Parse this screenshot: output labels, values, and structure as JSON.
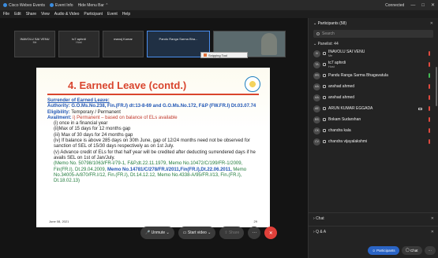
{
  "titlebar": {
    "app": "Cisco Webex Events",
    "event": "Event Info",
    "hide_menu": "Hide Menu Bar",
    "connected": "Connected",
    "win_min": "—",
    "win_max": "□",
    "win_close": "✕"
  },
  "menubar": {
    "items": [
      "File",
      "Edit",
      "Share",
      "View",
      "Audio & Video",
      "Participant",
      "Event",
      "Help"
    ]
  },
  "thumbs": [
    {
      "name": "INAVOLU SAI VENU",
      "sub": "Me"
    },
    {
      "name": "tc7 aphrdi",
      "sub": "Host"
    },
    {
      "name": "manoj Kumar",
      "sub": ""
    },
    {
      "name": "Pandu Ranga Sarma Bha..."
    }
  ],
  "snipping_tool": "Snipping Tool",
  "slide": {
    "title": "4. Earned Leave (contd.)",
    "lines": {
      "l1": "Surrender of Earned Leave:",
      "l2a": "Authority:",
      "l2b": " G.O.Ms.No.238, Fin.(FR.I) dt:13-8-69 and G.O.Ms.No.172, F&P (FW.FR.I) Dt.03.07.74",
      "l3a": "Eligibility:",
      "l3b": " Temporary / Permanent",
      "l4a": "Availment:",
      "l4b": " i) Permanent – based on balance of ELs available",
      "l5": "(i) once in a financial year",
      "l6": "(ii)Max of 15 days for 12 months gap",
      "l7": "(iii) Max of 30 days for 24 months gap",
      "l8": "(iv) If balance is above 285 days on 30th June, gap of 12/24 months need not be observed for sanction of SEL of 15/30 days respectively as on 1st July.",
      "l9": "(v) Advance credit of ELs for that half year will be credited after deducting surrendered days if he avails SEL on 1st of Jan/July.",
      "memo_a": "(Memo No. 50798/1063/FR-I/79-1, F&P,dt.22.11.1979, Memo No.10472/C/199/FR-1/2009, Fin(FR.I), Dt.29.04.2009, ",
      "memo_b": "Memo No.14781/C/278/FR.I/2011,Fin(FR.I),Dt.22.06.2011,",
      "memo_c": " Memo No.34005-A/870/FR.I/12, Fin.(FR.I), Dt.14.12.12,    Memo No.4338-A/95/FR.I/13, Fin.(FR.I), Dt.18.02.13)"
    },
    "date": "June 08, 2021",
    "page": "29"
  },
  "controls": {
    "unmute": "Unmute",
    "start_video": "Start video",
    "share": "Share",
    "more": "···",
    "end": "✕"
  },
  "panel": {
    "title": "Participants (58)",
    "search_placeholder": "Search",
    "panelist_header": "Panelist: 44",
    "participants": [
      {
        "initials": "IV",
        "name": "INAVOLU SAI VENU",
        "sub": "Me"
      },
      {
        "initials": "TA",
        "name": "tc7 aphrdi",
        "sub": "Host"
      },
      {
        "initials": "PR",
        "name": "Pandu Ranga Sarma Bhagavatula",
        "sub": ""
      },
      {
        "initials": "AA",
        "name": "anshad ahmed",
        "sub": ""
      },
      {
        "initials": "AA",
        "name": "anshad ahmed",
        "sub": ""
      },
      {
        "initials": "AE",
        "name": "ARUN KUMAR EGGADA",
        "sub": ""
      },
      {
        "initials": "BS",
        "name": "Bokam Sudarshan",
        "sub": ""
      },
      {
        "initials": "CK",
        "name": "chandra kala",
        "sub": ""
      },
      {
        "initials": "CV",
        "name": "chandra vijayalakshmi",
        "sub": ""
      }
    ],
    "chat": "Chat",
    "qa": "Q & A",
    "btn_participants": "Participants",
    "btn_chat": "Chat",
    "btn_more": "···"
  }
}
